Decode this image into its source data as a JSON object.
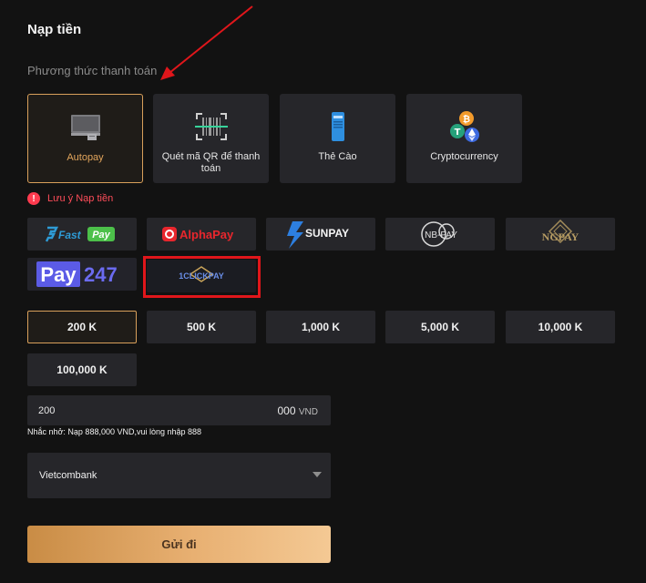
{
  "page": {
    "title": "Nạp tiền",
    "payment_method_label": "Phương thức thanh toán"
  },
  "methods": [
    {
      "label": "Autopay",
      "icon": "monitor-icon",
      "active": true
    },
    {
      "label": "Quét mã QR để thanh toán",
      "icon": "qr-scan-icon",
      "active": false
    },
    {
      "label": "Thẻ Cào",
      "icon": "scratch-card-icon",
      "active": false
    },
    {
      "label": "Cryptocurrency",
      "icon": "crypto-coins-icon",
      "active": false
    }
  ],
  "notice": {
    "text": "Lưu ý Nạp tiền"
  },
  "banks": {
    "fastpay": {
      "fast": "Fast",
      "pay": "Pay"
    },
    "alphapay": "AlphaPay",
    "sunpay": "SUNPAY",
    "nbpay": "NB-PAY",
    "ngpay": "NGPAY",
    "pay247": {
      "pay": "Pay",
      "num": "247"
    },
    "oneclickpay": "1CLICKPAY"
  },
  "amounts": [
    "200 K",
    "500 K",
    "1,000 K",
    "5,000 K",
    "10,000 K",
    "100,000 K"
  ],
  "amount_input": {
    "value": "200",
    "suffix_num": "000",
    "suffix_unit": "VND"
  },
  "reminder": "Nhắc nhở: Nạp 888,000 VND,vui lòng nhập 888",
  "bank_select": {
    "value": "Vietcombank"
  },
  "submit_label": "Gửi đi",
  "colors": {
    "accent": "#d9a05b",
    "highlight": "#e0161b",
    "notice": "#ff4d5a"
  }
}
